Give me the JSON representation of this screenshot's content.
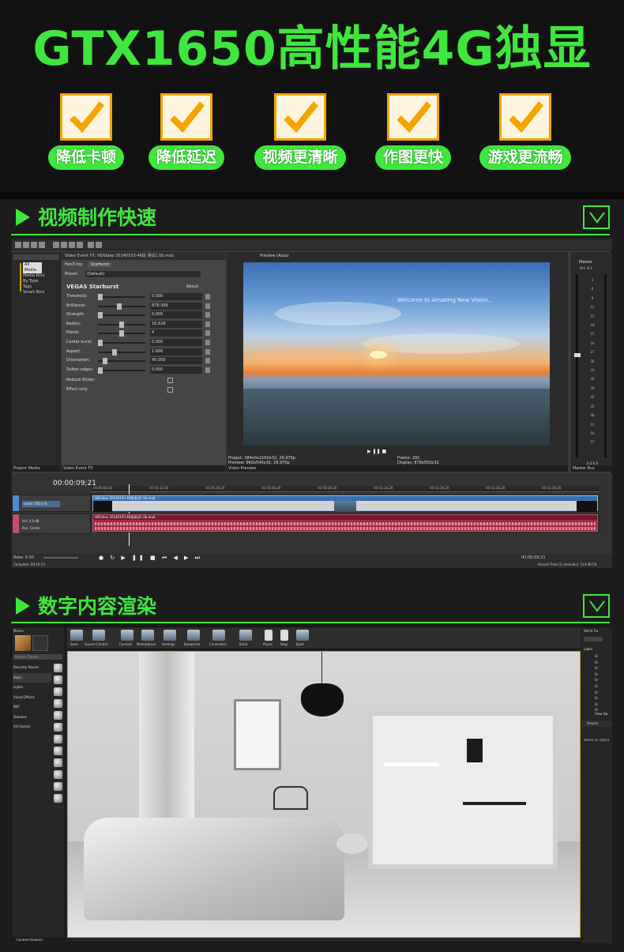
{
  "hero": {
    "title": "GTX1650高性能4G独显",
    "features": [
      "降低卡顿",
      "降低延迟",
      "视频更清晰",
      "作图更快",
      "游戏更流畅"
    ]
  },
  "colors": {
    "accent": "#3fe63d",
    "check_border": "#f5a300",
    "check_mark": "#f5a300"
  },
  "sections": [
    {
      "title": "视频制作快速",
      "toggle_icon": "chevron-down-icon"
    },
    {
      "title": "数字内容渲染",
      "toggle_icon": "chevron-down-icon"
    }
  ],
  "vegas": {
    "media_list": [
      "All Media",
      "Media Bins",
      "By Type",
      "Tags",
      "Smart Bins"
    ],
    "left_footer": "Project Media",
    "fx_tab": "Video Event FX: HDVideo 20140103-46段 测试1.0b.mxb",
    "fx_chain": [
      "Pan/Crop",
      "Starburst"
    ],
    "preset_label": "Preset:",
    "preset_value": "(Default)",
    "plugin_name": "VEGAS Starburst",
    "about": "About",
    "params": [
      {
        "label": "Threshold:",
        "value": "0.000",
        "level": 0.0
      },
      {
        "label": "Brilliance:",
        "value": "878.399",
        "level": 0.45
      },
      {
        "label": "Strength:",
        "value": "0.000",
        "level": 0.0
      },
      {
        "label": "Radius:",
        "value": "16.628",
        "level": 0.5
      },
      {
        "label": "Points:",
        "value": "4",
        "level": 0.5
      },
      {
        "label": "Center burst:",
        "value": "0.000",
        "level": 0.0
      },
      {
        "label": "Aspect:",
        "value": "1.000",
        "level": 0.33
      },
      {
        "label": "Orientation:",
        "value": "45.000",
        "level": 0.12
      },
      {
        "label": "Soften edges:",
        "value": "0.000",
        "level": 0.0
      }
    ],
    "checks": [
      "Reduce flicker:",
      "Effect only:"
    ],
    "fx_footer": "Video Event FX",
    "preview_mode": "Preview (Auto)",
    "preview_caption": "Welcome to Amazing New Vision...",
    "preview_info": {
      "project": "Project:  384x0x2160x32, 29.970p",
      "preview": "Preview:  960x540x32, 29.970p",
      "frame": "Frame:  291",
      "display": "Display:  878x550x32"
    },
    "preview_footer": "Video Preview",
    "mixer_title": "Master",
    "mixer_levels": [
      "-9.4",
      "-6.1"
    ],
    "mixer_scale": [
      "3",
      "6",
      "9",
      "12",
      "15",
      "18",
      "21",
      "24",
      "27",
      "30",
      "33",
      "36",
      "39",
      "42",
      "45",
      "48",
      "51",
      "54",
      "57"
    ],
    "mixer_bottom": [
      "0.0",
      "0.0"
    ],
    "mixer_footer": "Master Bus",
    "timecode": "00:00:09;21",
    "ruler_marks": [
      "00:00:00;00",
      "00:00:15;00",
      "00:00:29;29",
      "00:00:44;29",
      "00:00:59;28",
      "00:01:14;28",
      "00:01:29;29",
      "00:01:44;29",
      "00:01:59;28"
    ],
    "video_track": {
      "level": "Level: 100.0 %",
      "clip": "HDVideo 20140103-46段测试1.0b.mxb"
    },
    "audio_track": {
      "vol_label": "Vol:",
      "vol": "0.0 dB",
      "pan_label": "Pan:",
      "pan": "Center",
      "clip": "HDVideo 20140103-46段测试1.0b.mxb"
    },
    "rate": "Rate: 0.00",
    "transport_tc": "00:00:09;21",
    "complete": "Complete: 00:10:13",
    "record_time": "Record Time (2 channels): 123:46:58"
  },
  "unreal": {
    "modes_title": "Modes",
    "search_placeholder": "Search Classes",
    "categories": [
      "Recently Placed",
      "Basic",
      "Lights",
      "Visual Effects",
      "BSP",
      "Volumes",
      "All Classes"
    ],
    "toolbar": [
      "Save",
      "Source Control",
      "Content",
      "Marketplace",
      "Settings",
      "Blueprints",
      "Cinematics",
      "Build",
      "Pause",
      "Stop",
      "Eject"
    ],
    "content_footer": "Content Browser",
    "outliner_title": "World Ou",
    "outliner_label": "Label",
    "outliner_rows": [
      "Br",
      "Br",
      "Br",
      "Br",
      "Br",
      "Br",
      "Br",
      "Br",
      "Br",
      "Br"
    ],
    "view_options": "View Op",
    "details_title": "Details",
    "details_hint": "Select an object"
  }
}
